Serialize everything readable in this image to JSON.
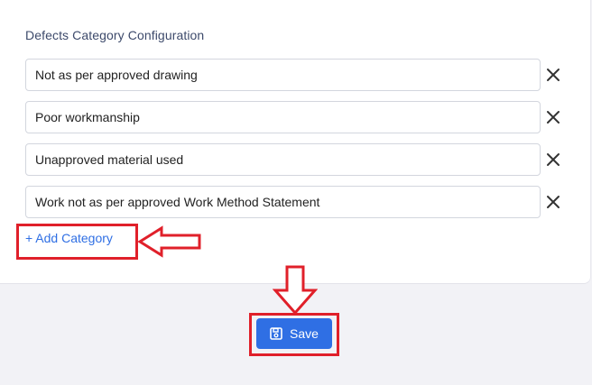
{
  "section": {
    "title": "Defects Category Configuration"
  },
  "categories": [
    {
      "value": "Not as per approved drawing",
      "remove_icon": "close-icon"
    },
    {
      "value": "Poor workmanship",
      "remove_icon": "close-icon"
    },
    {
      "value": "Unapproved material used",
      "remove_icon": "close-icon"
    },
    {
      "value": "Work not as per approved Work Method Statement",
      "remove_icon": "close-icon"
    }
  ],
  "actions": {
    "add_category_label": "+ Add Category",
    "save_label": "Save",
    "save_icon": "floppy-disk-icon"
  },
  "colors": {
    "accent": "#2f6fe4",
    "annotation": "#e0202a",
    "page_background": "#f2f2f6",
    "card_background": "#ffffff"
  },
  "annotations": {
    "left_arrow_icon": "left-arrow-icon",
    "down_arrow_icon": "down-arrow-icon"
  }
}
